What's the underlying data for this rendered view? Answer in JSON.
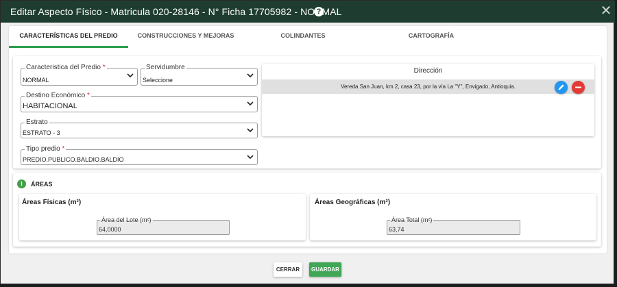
{
  "dialog": {
    "title": "Editar Aspecto Físico - Matricula 020-28146 - N° Ficha 17705982 - NORMAL",
    "help_glyph": "?",
    "close_glyph": "✕"
  },
  "tabs": [
    {
      "label": "CARACTERÍSTICAS DEL PREDIO",
      "active": true
    },
    {
      "label": "CONSTRUCCIONES Y MEJORAS",
      "active": false
    },
    {
      "label": "COLINDANTES",
      "active": false
    },
    {
      "label": "CARTOGRAFÍA",
      "active": false
    }
  ],
  "form": {
    "caracteristica": {
      "label": "Caracteristica del Predio",
      "required_mark": "*",
      "value": "NORMAL"
    },
    "servidumbre": {
      "label": "Servidumbre",
      "value": "Seleccione"
    },
    "destino": {
      "label": "Destino Económico",
      "required_mark": "*",
      "value": "HABITACIONAL"
    },
    "estrato": {
      "label": "Estrato",
      "value": "ESTRATO - 3"
    },
    "tipo_predio": {
      "label": "Tipo predio",
      "required_mark": "*",
      "value": "PREDIO.PUBLICO.BALDIO.BALDIO"
    }
  },
  "direccion": {
    "header": "Dirección",
    "rows": [
      "Vereda San Juan, km 2, casa 23, por la vía La \"Y\", Envigado, Antioquia."
    ],
    "edit_color": "#2196f3",
    "delete_color": "#e53935"
  },
  "areas": {
    "title": "ÁREAS",
    "fisicas": {
      "title": "Áreas Físicas (m²)",
      "field_label": "Área del Lote (m²)",
      "value": "64,0000"
    },
    "geograficas": {
      "title": "Áreas Geográficas (m²)",
      "field_label": "Área Total (m²)",
      "value": "63,74"
    }
  },
  "footer": {
    "cerrar_label": "CERRAR",
    "guardar_label": "GUARDAR",
    "guardar_color": "#3fa756"
  },
  "colors": {
    "header_bg": "#1e3d30",
    "tab_indicator": "#2e9e4e"
  }
}
